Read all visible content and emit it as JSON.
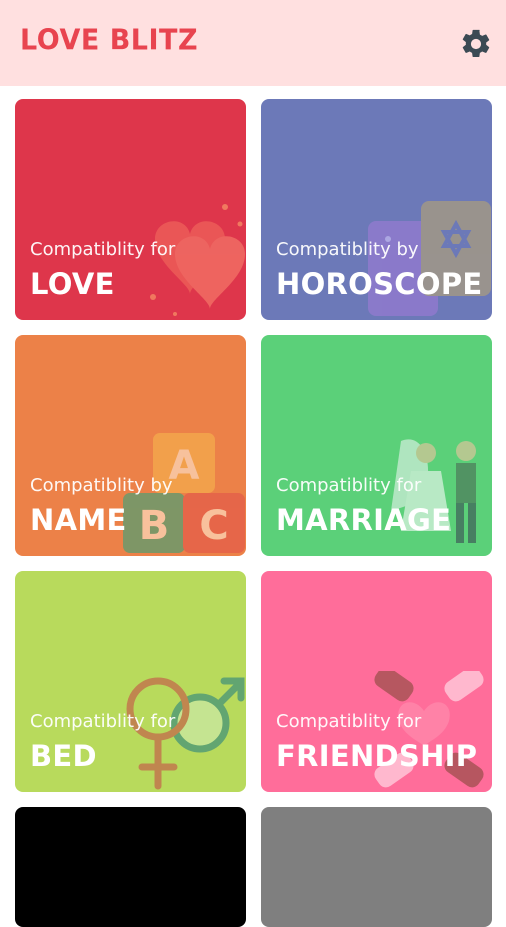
{
  "app": {
    "title": "LOVE BLITZ"
  },
  "cards": [
    {
      "sub": "Compatiblity for",
      "title": "LOVE",
      "color": "#de364b",
      "icon": "hearts-icon"
    },
    {
      "sub": "Compatiblity by",
      "title": "HOROSCOPE",
      "color": "#6c79b8",
      "icon": "horoscope-cards-icon"
    },
    {
      "sub": "Compatiblity by",
      "title": "NAME",
      "color": "#ec8148",
      "icon": "abc-blocks-icon"
    },
    {
      "sub": "Compatiblity for",
      "title": "MARRIAGE",
      "color": "#5bd079",
      "icon": "wedding-couple-icon"
    },
    {
      "sub": "Compatiblity for",
      "title": "BED",
      "color": "#b8da5c",
      "icon": "gender-symbols-icon"
    },
    {
      "sub": "Compatiblity for",
      "title": "FRIENDSHIP",
      "color": "#ff6d9a",
      "icon": "joined-hands-icon"
    },
    {
      "sub": "",
      "title": "",
      "color": "#000000",
      "icon": ""
    },
    {
      "sub": "",
      "title": "",
      "color": "#7f7f7f",
      "icon": ""
    }
  ]
}
